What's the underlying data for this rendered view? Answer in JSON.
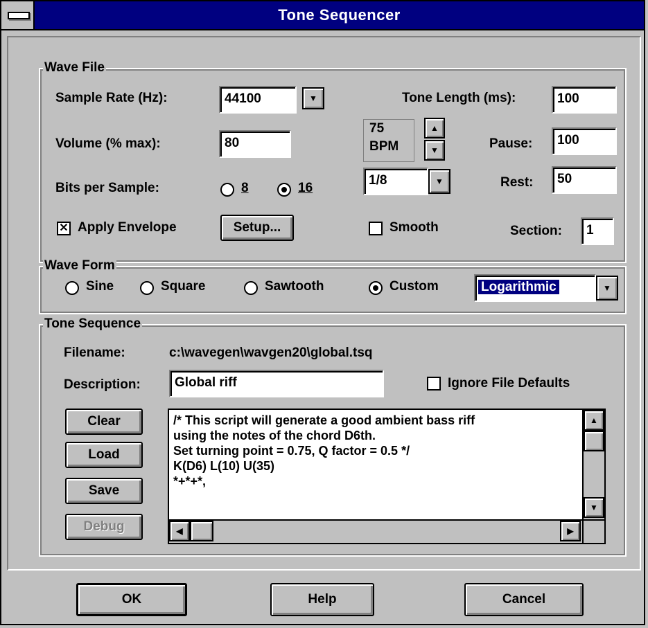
{
  "window": {
    "title": "Tone Sequencer"
  },
  "wave_file": {
    "legend": "Wave File",
    "sample_rate_label": "Sample Rate (Hz):",
    "sample_rate_value": "44100",
    "volume_label": "Volume (% max):",
    "volume_value": "80",
    "bits_label": "Bits per Sample:",
    "bits_options": [
      "8",
      "16"
    ],
    "bits_selected": "16",
    "apply_envelope_label": "Apply Envelope",
    "apply_envelope_checked": true,
    "setup_label": "Setup...",
    "tone_length_label": "Tone Length (ms):",
    "tone_length_value": "100",
    "bpm_value": "75",
    "bpm_unit": "BPM",
    "note_value": "1/8",
    "pause_label": "Pause:",
    "pause_value": "100",
    "rest_label": "Rest:",
    "rest_value": "50",
    "smooth_label": "Smooth",
    "smooth_checked": false,
    "section_label": "Section:",
    "section_value": "1"
  },
  "wave_form": {
    "legend": "Wave Form",
    "options": [
      "Sine",
      "Square",
      "Sawtooth",
      "Custom"
    ],
    "selected": "Custom",
    "custom_type": "Logarithmic"
  },
  "tone_sequence": {
    "legend": "Tone Sequence",
    "filename_label": "Filename:",
    "filename_value": "c:\\wavegen\\wavgen20\\global.tsq",
    "description_label": "Description:",
    "description_value": "Global riff",
    "ignore_defaults_label": "Ignore File Defaults",
    "ignore_defaults_checked": false,
    "buttons": {
      "clear": "Clear",
      "load": "Load",
      "save": "Save",
      "debug": "Debug"
    },
    "script_lines": [
      "/* This script will generate a good ambient bass riff",
      "using the notes of the chord D6th.",
      "Set turning point = 0.75, Q factor = 0.5 */",
      "K(D6) L(10) U(35)",
      "*+*+*,"
    ]
  },
  "footer": {
    "ok": "OK",
    "help": "Help",
    "cancel": "Cancel"
  },
  "icons": {
    "system_menu": "system-menu-icon",
    "arrow_up": "▲",
    "arrow_down": "▼",
    "arrow_left": "◀",
    "arrow_right": "▶"
  },
  "colors": {
    "titlebar": "#000080",
    "face": "#c0c0c0",
    "highlight": "#000080"
  }
}
